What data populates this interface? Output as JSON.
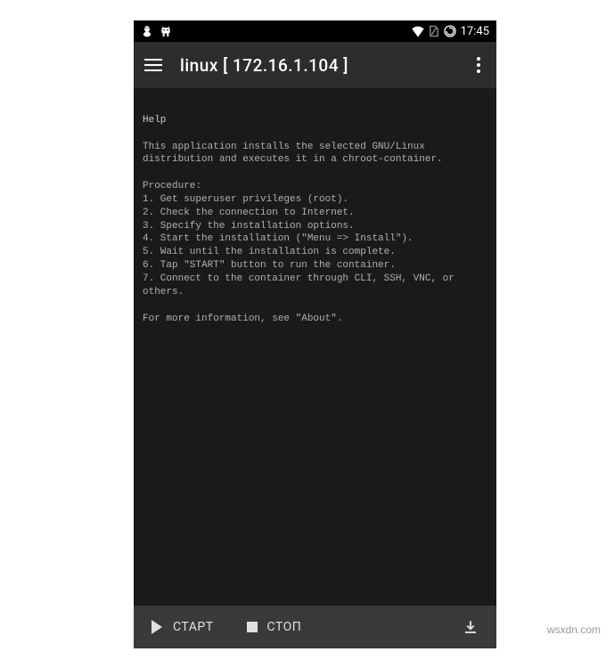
{
  "statusbar": {
    "time": "17:45"
  },
  "appbar": {
    "title": "linux  [ 172.16.1.104 ]"
  },
  "help": {
    "heading": "Help",
    "intro": "This application installs the selected GNU/Linux distribution and executes it in a chroot-container.",
    "procedure_label": "Procedure:",
    "steps": [
      "1. Get superuser privileges (root).",
      "2. Check the connection to Internet.",
      "3. Specify the installation options.",
      "4. Start the installation (\"Menu => Install\").",
      "5. Wait until the installation is complete.",
      "6. Tap \"START\" button to run the container.",
      "7. Connect to the container through CLI, SSH, VNC, or others."
    ],
    "footer": "For more information, see \"About\"."
  },
  "bottombar": {
    "start": "СТАРТ",
    "stop": "СТОП"
  },
  "watermark": "wsxdn.com"
}
